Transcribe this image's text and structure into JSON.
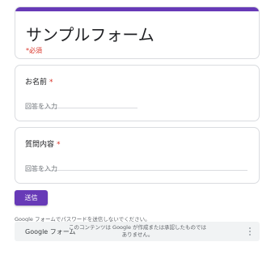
{
  "colors": {
    "accent": "#673ab7",
    "required": "#d93025",
    "border": "#dadce0",
    "footer_bg": "#f1f3f4"
  },
  "form": {
    "title": "サンプルフォーム",
    "required_note": "*必須"
  },
  "questions": [
    {
      "label": "お名前",
      "required_mark": "*",
      "placeholder": "回答を入力",
      "value": ""
    },
    {
      "label": "質問内容",
      "required_mark": "*",
      "placeholder": "回答を入力",
      "value": ""
    }
  ],
  "submit": {
    "label": "送信"
  },
  "password_warning": "Google フォームでパスワードを送信しないでください。",
  "footer": {
    "brand": "Google フォーム",
    "disclaimer": "このコンテンツは Google が作成または承認したものでは ありません。",
    "more_icon": "more-vert-icon"
  }
}
